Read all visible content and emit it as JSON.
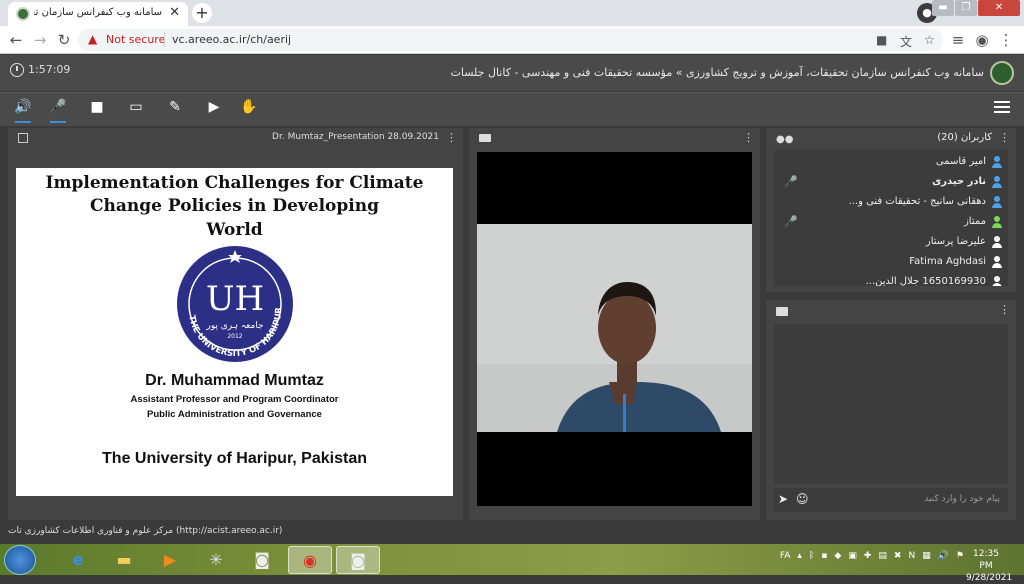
{
  "browser": {
    "tab_title": "سامانه وب کنفرانس سازمان تحقیقات",
    "new_tab": "+",
    "not_secure": "Not secure",
    "url": "vc.areeo.ac.ir/ch/aerij",
    "win_min": "▬",
    "win_max": "❐",
    "win_close": "✕"
  },
  "app": {
    "timer": "1:57:09",
    "title": "سامانه وب کنفرانس سازمان تحقیقات، آموزش و ترویج کشاورزی » مؤسسه تحقیقات فنی و مهندسی - کانال جلسات",
    "footer": "مرکز علوم و فناوری اطلاعات کشاورزی تات (http://acist.areeo.ac.ir)"
  },
  "toolbar": {
    "icons": [
      "speaker-icon",
      "microphone-icon",
      "camera-icon",
      "screen-share-icon",
      "brush-icon",
      "play-media-icon",
      "raise-hand-icon"
    ],
    "speaker": "🔊",
    "mic": "🎤",
    "cam": "■",
    "screen": "▭",
    "brush": "✎",
    "play": "▶",
    "hand": "✋"
  },
  "presentation": {
    "filename": "Dr. Mumtaz_Presentation 28.09.2021",
    "slide": {
      "title_line1": "Implementation Challenges for Climate Change Policies in Developing",
      "title_line2": "World",
      "seal_text": "UH",
      "seal_ring": "THE UNIVERSITY OF HARIPUR",
      "seal_urdu": "جامعہ ہری پور",
      "seal_year": "2012",
      "speaker": "Dr. Muhammad Mumtaz",
      "role": "Assistant Professor and Program Coordinator",
      "dept": "Public Administration and Governance",
      "university": "The University of Haripur,  Pakistan"
    }
  },
  "users": {
    "header": "کاربران (20)",
    "list": [
      {
        "name": "امیر قاسمی",
        "bold": false,
        "icon_color": "#4aa3e8",
        "mic": ""
      },
      {
        "name": "نادر حیدری",
        "bold": true,
        "icon_color": "#4aa3e8",
        "mic": "🎤"
      },
      {
        "name": "دهقانی سانیج - تحقیقات فنی و...",
        "bold": false,
        "icon_color": "#4aa3e8",
        "mic": ""
      },
      {
        "name": "ممتاز",
        "bold": false,
        "icon_color": "#7ed957",
        "mic": "🎤"
      },
      {
        "name": "علیرضا پرستار",
        "bold": false,
        "icon_color": "#ffffff",
        "mic": ""
      },
      {
        "name": "Fatima Aghdasi",
        "bold": false,
        "icon_color": "#ffffff",
        "mic": ""
      },
      {
        "name": "1650169930 جلال الدین...",
        "bold": false,
        "icon_color": "#ffffff",
        "mic": ""
      }
    ]
  },
  "chat": {
    "placeholder": "پیام خود را وارد کنید",
    "send": "➤",
    "emoji": "☺"
  },
  "taskbar": {
    "apps": [
      "ie-icon",
      "folder-icon",
      "media-player-icon",
      "network-icon",
      "camera-app-icon",
      "chrome-icon",
      "camera-app-icon-2"
    ],
    "lang": "FA",
    "time": "12:35 PM",
    "date": "9/28/2021"
  }
}
